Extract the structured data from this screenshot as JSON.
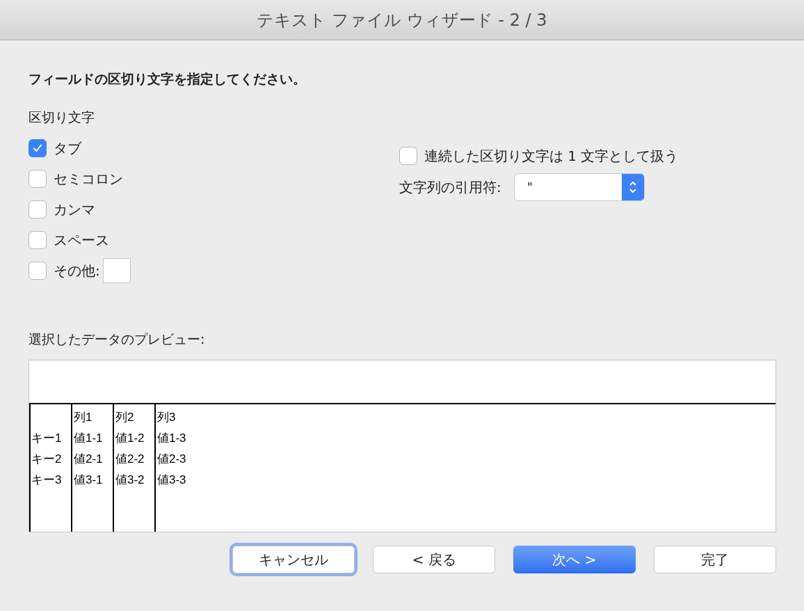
{
  "window": {
    "title": "テキスト ファイル ウィザード - 2 / 3"
  },
  "instruction": "フィールドの区切り文字を指定してください。",
  "delimiters": {
    "label": "区切り文字",
    "options": [
      {
        "label": "タブ",
        "checked": true
      },
      {
        "label": "セミコロン",
        "checked": false
      },
      {
        "label": "カンマ",
        "checked": false
      },
      {
        "label": "スペース",
        "checked": false
      },
      {
        "label": "その他:",
        "checked": false,
        "has_field": true
      }
    ]
  },
  "consecutive": {
    "label": "連続した区切り文字は 1 文字として扱う",
    "checked": false
  },
  "text_qualifier": {
    "label": "文字列の引用符:",
    "value": "\""
  },
  "preview": {
    "label": "選択したデータのプレビュー:",
    "rows": [
      [
        "",
        "列1",
        "列2",
        "列3"
      ],
      [
        "キー1",
        "値1-1",
        "値1-2",
        "値1-3"
      ],
      [
        "キー2",
        "値2-1",
        "値2-2",
        "値2-3"
      ],
      [
        "キー3",
        "値3-1",
        "値3-2",
        "値3-3"
      ]
    ]
  },
  "buttons": [
    {
      "label": "キャンセル",
      "kind": "focused"
    },
    {
      "label": "< 戻る",
      "kind": "normal"
    },
    {
      "label": "次へ >",
      "kind": "default"
    },
    {
      "label": "完了",
      "kind": "normal"
    }
  ]
}
